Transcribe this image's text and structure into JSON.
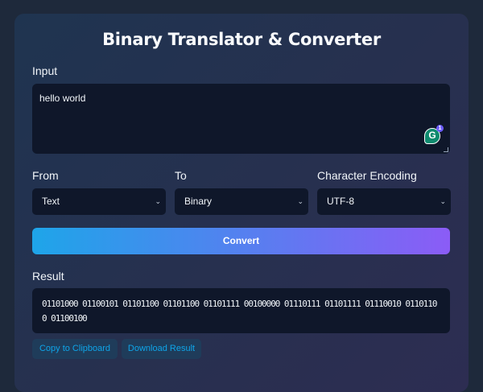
{
  "title": "Binary Translator & Converter",
  "input": {
    "label": "Input",
    "value": "hello world",
    "grammarly_count": "1"
  },
  "from": {
    "label": "From",
    "value": "Text"
  },
  "to": {
    "label": "To",
    "value": "Binary"
  },
  "encoding": {
    "label": "Character Encoding",
    "value": "UTF-8"
  },
  "convert_label": "Convert",
  "result": {
    "label": "Result",
    "value": "01101000 01100101 01101100 01101100 01101111 00100000 01110111 01101111 01110010 01101100 01100100"
  },
  "copy_label": "Copy to Clipboard",
  "download_label": "Download Result"
}
